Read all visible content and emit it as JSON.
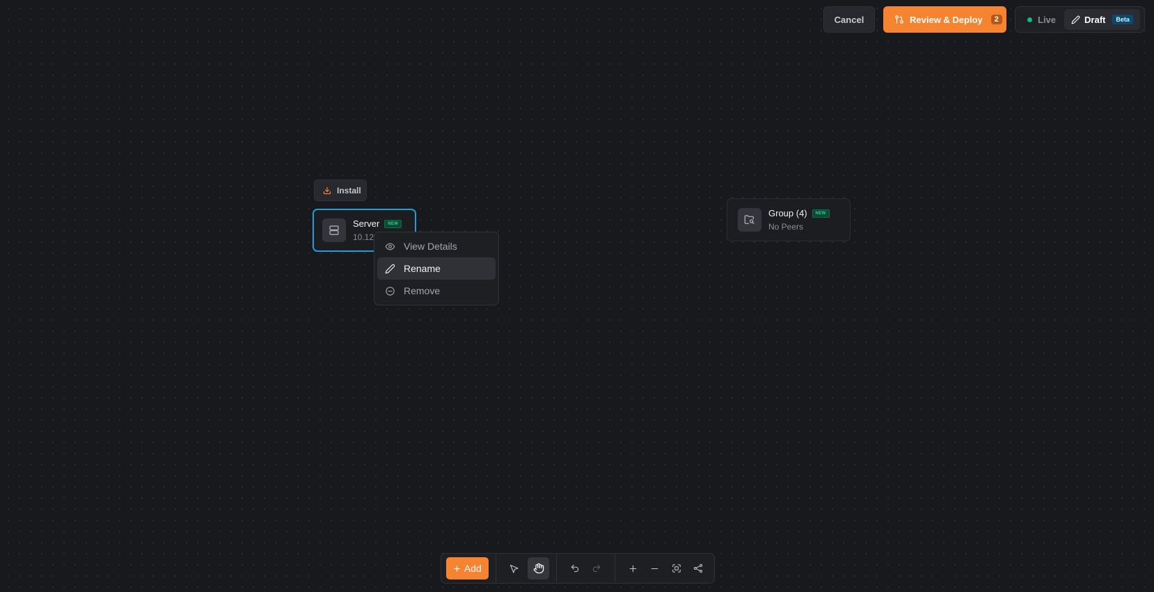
{
  "topbar": {
    "cancel_label": "Cancel",
    "deploy_label": "Review & Deploy",
    "deploy_count": "2",
    "mode_live_label": "Live",
    "mode_draft_label": "Draft",
    "beta_badge": "Beta"
  },
  "canvas": {
    "install_label": "Install",
    "server_node": {
      "title": "Server",
      "badge": "NEW",
      "subtitle": "10.12"
    },
    "group_node": {
      "title": "Group (4)",
      "badge": "NEW",
      "subtitle": "No Peers"
    }
  },
  "context_menu": {
    "items": [
      {
        "label": "View Details",
        "icon": "eye-icon"
      },
      {
        "label": "Rename",
        "icon": "pencil-icon",
        "active": true
      },
      {
        "label": "Remove",
        "icon": "minus-circle-icon"
      }
    ]
  },
  "toolbar": {
    "add_label": "Add",
    "tools": [
      "pointer-icon",
      "hand-icon",
      "undo-icon",
      "redo-icon",
      "zoom-in-icon",
      "zoom-out-icon",
      "fit-view-icon",
      "auto-layout-icon"
    ],
    "active_tool": "hand-icon"
  },
  "colors": {
    "accent": "#f68330",
    "selection": "#1c9fdc",
    "live": "#14b77c",
    "background": "#18191d"
  }
}
